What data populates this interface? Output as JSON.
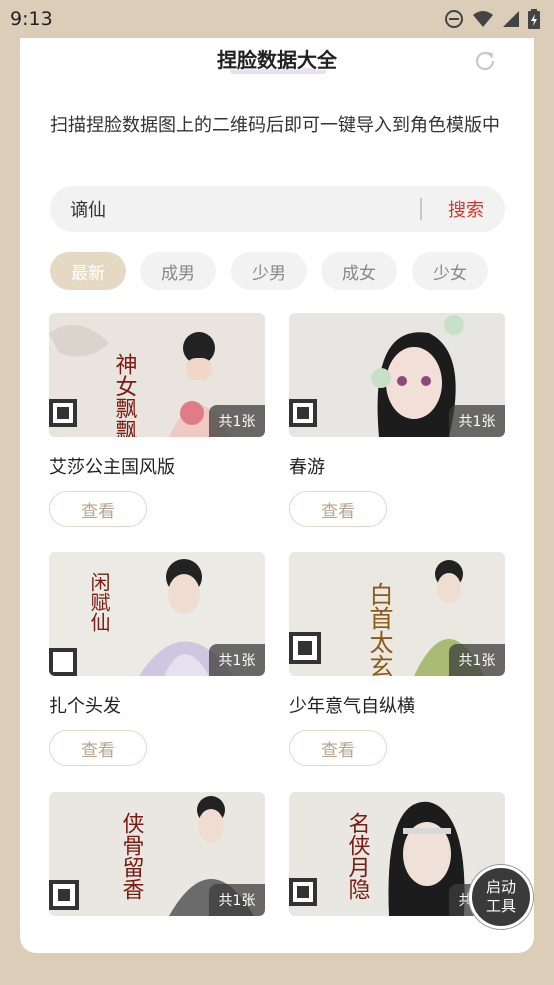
{
  "status": {
    "time": "9:13"
  },
  "header": {
    "title": "捏脸数据大全",
    "refresh_icon": "refresh-icon"
  },
  "description": "扫描捏脸数据图上的二维码后即可一键导入到角色模版中",
  "search": {
    "value": "谪仙",
    "button_label": "搜索"
  },
  "categories": [
    {
      "label": "最新",
      "active": true
    },
    {
      "label": "成男",
      "active": false
    },
    {
      "label": "少男",
      "active": false
    },
    {
      "label": "成女",
      "active": false
    },
    {
      "label": "少女",
      "active": false
    }
  ],
  "items": [
    {
      "title": "艾莎公主国风版",
      "count": "共1张",
      "view_label": "查看",
      "calligraphy": "神女飘飘"
    },
    {
      "title": "春游",
      "count": "共1张",
      "view_label": "查看",
      "calligraphy": ""
    },
    {
      "title": "扎个头发",
      "count": "共1张",
      "view_label": "查看",
      "calligraphy": "闲赋仙"
    },
    {
      "title": "少年意气自纵横",
      "count": "共1张",
      "view_label": "查看",
      "calligraphy": "白首太玄"
    },
    {
      "title": "",
      "count": "共1张",
      "view_label": "",
      "calligraphy": "侠骨留香"
    },
    {
      "title": "",
      "count": "共1张",
      "view_label": "",
      "calligraphy": "名侠月隐"
    }
  ],
  "fab": {
    "line1": "启动",
    "line2": "工具"
  },
  "colors": {
    "background": "#dccdb8",
    "accent_red": "#d6362a",
    "chip_active": "#e6d9c4"
  }
}
